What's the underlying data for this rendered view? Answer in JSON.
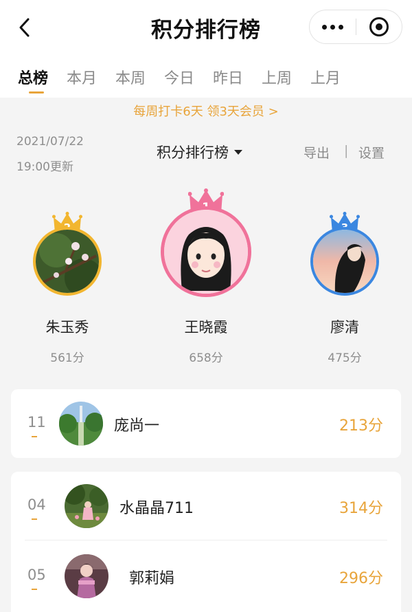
{
  "header": {
    "title": "积分排行榜"
  },
  "tabs": [
    {
      "label": "总榜",
      "active": true
    },
    {
      "label": "本月"
    },
    {
      "label": "本周"
    },
    {
      "label": "今日"
    },
    {
      "label": "昨日"
    },
    {
      "label": "上周"
    },
    {
      "label": "上月"
    }
  ],
  "promo": "每周打卡6天 领3天会员 >",
  "info": {
    "date": "2021/07/22",
    "update_time": "19:00更新",
    "selector_label": "积分排行榜",
    "export_label": "导出",
    "divider": "|",
    "settings_label": "设置"
  },
  "podium": {
    "first": {
      "rank": "1",
      "name": "王晓霞",
      "score": "658分",
      "crown_color": "#f0729a"
    },
    "second": {
      "rank": "2",
      "name": "朱玉秀",
      "score": "561分",
      "crown_color": "#f2b630"
    },
    "third": {
      "rank": "3",
      "name": "廖清",
      "score": "475分",
      "crown_color": "#3b87e0"
    }
  },
  "my_rank": {
    "rank": "11",
    "name": "庞尚一",
    "score": "213分"
  },
  "list": [
    {
      "rank": "04",
      "name": "水晶晶711",
      "score": "314分"
    },
    {
      "rank": "05",
      "name": "郭莉娟",
      "score": "296分"
    }
  ],
  "colors": {
    "accent": "#e8a43a",
    "background": "#f4f4f4"
  }
}
